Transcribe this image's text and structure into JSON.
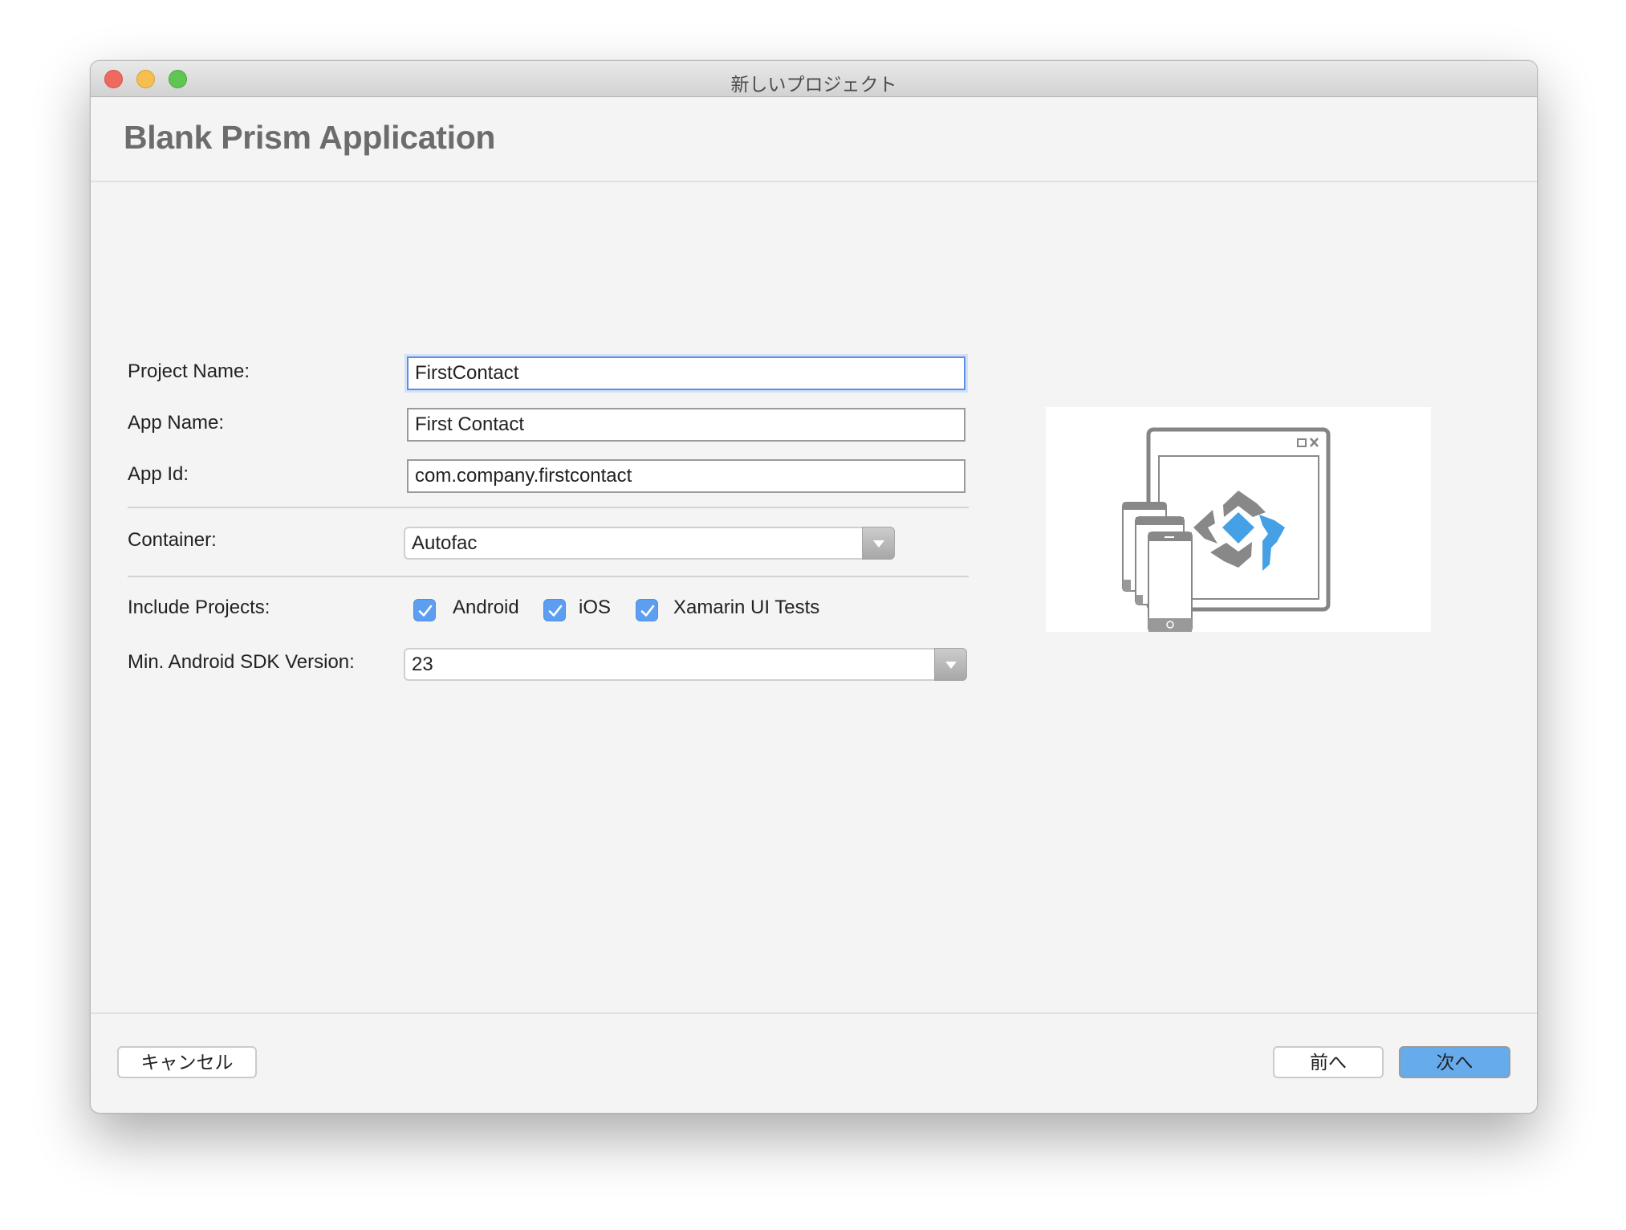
{
  "window": {
    "title": "新しいプロジェクト",
    "traffic_lights": [
      "close",
      "minimize",
      "zoom"
    ]
  },
  "header": {
    "title": "Blank Prism Application"
  },
  "form": {
    "project_name": {
      "label": "Project Name:",
      "value": "FirstContact",
      "focused": true
    },
    "app_name": {
      "label": "App Name:",
      "value": "First Contact"
    },
    "app_id": {
      "label": "App Id:",
      "value": "com.company.firstcontact"
    },
    "container": {
      "label": "Container:",
      "selected": "Autofac"
    },
    "include_projects": {
      "label": "Include Projects:",
      "options": [
        {
          "label": "Android",
          "checked": true
        },
        {
          "label": "iOS",
          "checked": true
        },
        {
          "label": "Xamarin UI Tests",
          "checked": true
        }
      ]
    },
    "min_sdk": {
      "label": "Min. Android SDK Version:",
      "selected": "23"
    }
  },
  "preview": {
    "icon": "prism-multi-platform-app-icon",
    "colors": {
      "gray": "#8a8a8a",
      "accent": "#45a0e6"
    }
  },
  "footer": {
    "cancel_label": "キャンセル",
    "previous_label": "前へ",
    "next_label": "次へ"
  },
  "colors": {
    "accent": "#66abec",
    "checkbox": "#5d9ef1",
    "focus_border": "#5b8ee8"
  }
}
